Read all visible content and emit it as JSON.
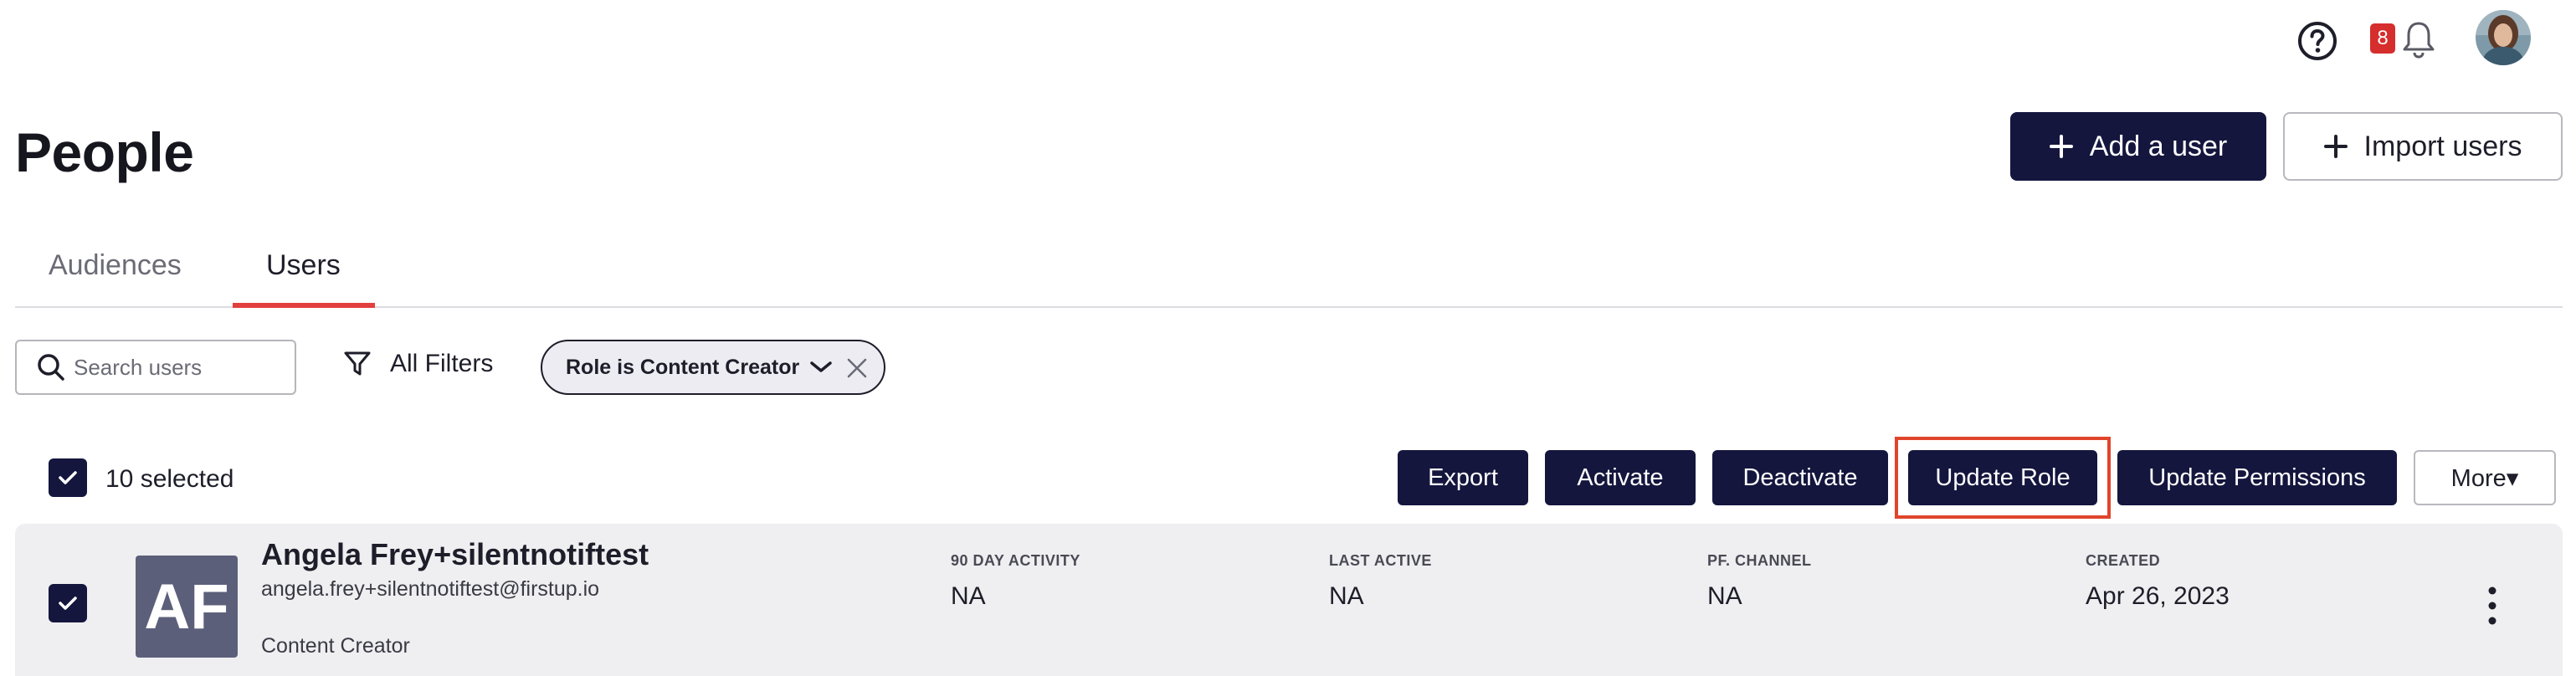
{
  "header": {
    "notification_count": "8",
    "icons": [
      "help-icon",
      "bell-icon",
      "avatar"
    ]
  },
  "page": {
    "title": "People",
    "add_user_label": "Add a user",
    "import_users_label": "Import users"
  },
  "tabs": [
    {
      "label": "Audiences",
      "active": false
    },
    {
      "label": "Users",
      "active": true
    }
  ],
  "filters": {
    "search_placeholder": "Search users",
    "all_filters_label": "All Filters",
    "active_chip": "Role is Content Creator"
  },
  "bulk_actions": {
    "selected_label": "10 selected",
    "export": "Export",
    "activate": "Activate",
    "deactivate": "Deactivate",
    "update_role": "Update Role",
    "update_permissions": "Update Permissions",
    "more": "More▾"
  },
  "columns": {
    "activity": "90 DAY ACTIVITY",
    "last_active": "LAST ACTIVE",
    "channel": "PF. CHANNEL",
    "created": "CREATED"
  },
  "users": [
    {
      "initials": "AF",
      "name": "Angela Frey+silentnotiftest",
      "email": "angela.frey+silentnotiftest@firstup.io",
      "role": "Content Creator",
      "activity": "NA",
      "last_active": "NA",
      "channel": "NA",
      "created": "Apr 26, 2023",
      "selected": true
    }
  ],
  "colors": {
    "primary": "#14163e",
    "accent": "#e2403f",
    "badge": "#d62d2d",
    "highlight": "#e0452c",
    "row_bg": "#efeff1"
  }
}
